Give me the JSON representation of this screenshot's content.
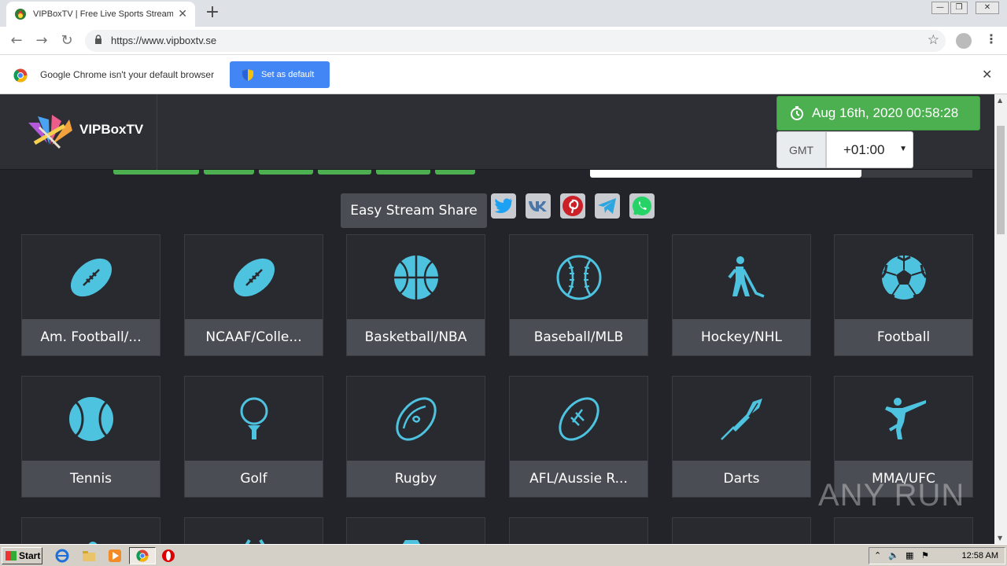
{
  "browser": {
    "tab_title": "VIPBoxTV | Free Live Sports Streams",
    "url": "https://www.vipboxtv.se",
    "infobar_message": "Google Chrome isn't your default browser",
    "set_default_label": "Set as default"
  },
  "site": {
    "logo_text": "VIPBoxTV",
    "datetime": "Aug 16th, 2020 00:58:28",
    "gmt_label": "GMT",
    "gmt_offset": "+01:00",
    "share_label": "Easy Stream Share",
    "social": [
      "twitter-icon",
      "vk-icon",
      "pinterest-icon",
      "telegram-icon",
      "whatsapp-icon"
    ],
    "accent_color": "#4caf50",
    "icon_color": "#4ec3e0",
    "categories": [
      {
        "label": "Am. Football/...",
        "icon": "american-football-icon"
      },
      {
        "label": "NCAAF/Colle...",
        "icon": "american-football-icon"
      },
      {
        "label": "Basketball/NBA",
        "icon": "basketball-icon"
      },
      {
        "label": "Baseball/MLB",
        "icon": "baseball-icon"
      },
      {
        "label": "Hockey/NHL",
        "icon": "hockey-icon"
      },
      {
        "label": "Football",
        "icon": "soccer-ball-icon"
      },
      {
        "label": "Tennis",
        "icon": "tennis-ball-icon"
      },
      {
        "label": "Golf",
        "icon": "golf-icon"
      },
      {
        "label": "Rugby",
        "icon": "rugby-ball-icon"
      },
      {
        "label": "AFL/Aussie R...",
        "icon": "afl-ball-icon"
      },
      {
        "label": "Darts",
        "icon": "dart-icon"
      },
      {
        "label": "MMA/UFC",
        "icon": "martial-arts-icon"
      }
    ],
    "watermark": "ANY RUN"
  },
  "taskbar": {
    "start_label": "Start",
    "clock": "12:58 AM"
  }
}
